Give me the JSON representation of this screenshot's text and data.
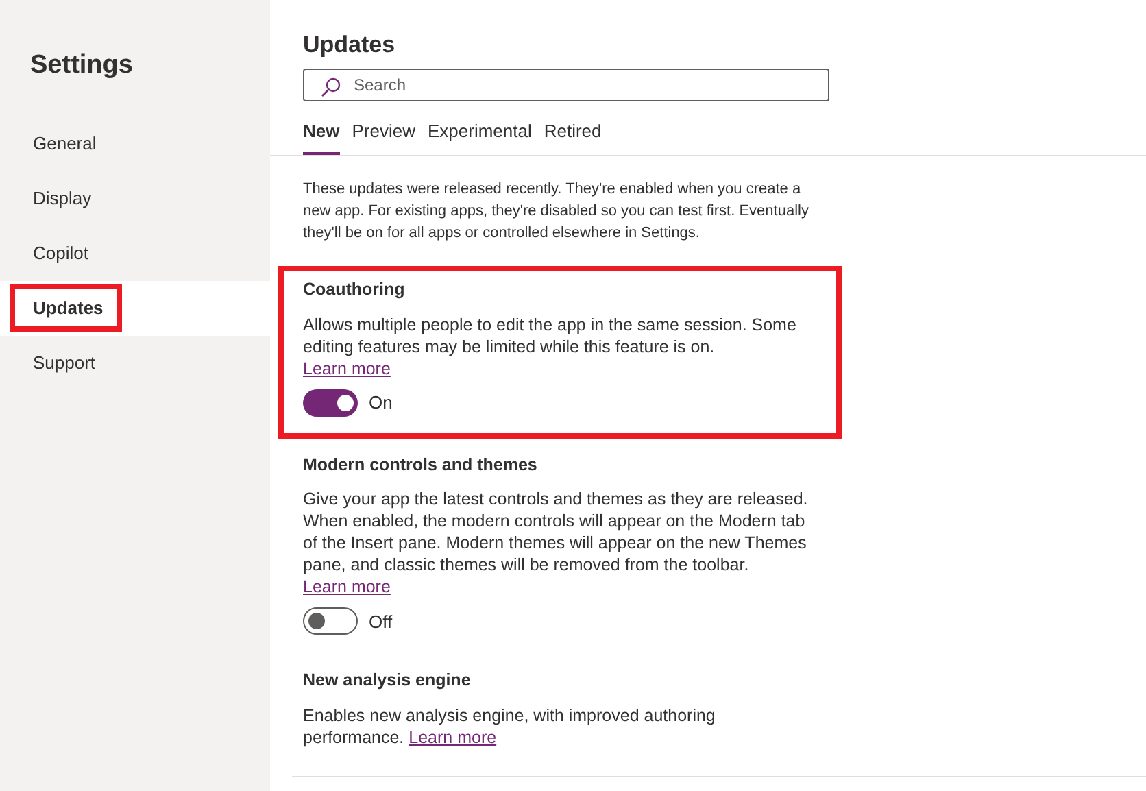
{
  "sidebar": {
    "title": "Settings",
    "items": [
      {
        "label": "General",
        "selected": false,
        "highlighted": false
      },
      {
        "label": "Display",
        "selected": false,
        "highlighted": false
      },
      {
        "label": "Copilot",
        "selected": false,
        "highlighted": false
      },
      {
        "label": "Updates",
        "selected": true,
        "highlighted": true
      },
      {
        "label": "Support",
        "selected": false,
        "highlighted": false
      }
    ]
  },
  "main": {
    "title": "Updates",
    "search": {
      "placeholder": "Search"
    },
    "tabs": [
      {
        "label": "New",
        "selected": true
      },
      {
        "label": "Preview",
        "selected": false
      },
      {
        "label": "Experimental",
        "selected": false
      },
      {
        "label": "Retired",
        "selected": false
      }
    ],
    "intro": "These updates were released recently. They're enabled when you create a new app. For existing apps, they're disabled so you can test first. Eventually they'll be on for all apps or controlled elsewhere in Settings.",
    "features": [
      {
        "title": "Coauthoring",
        "description": "Allows multiple people to edit the app in the same session. Some editing features may be limited while this feature is on.",
        "link": "Learn more",
        "highlighted": true,
        "toggle": {
          "on": true,
          "label": "On"
        }
      },
      {
        "title": "Modern controls and themes",
        "description": "Give your app the latest controls and themes as they are released. When enabled, the modern controls will appear on the Modern tab of the Insert pane. Modern themes will appear on the new Themes pane, and classic themes will be removed from the toolbar.",
        "link": "Learn more",
        "highlighted": false,
        "toggle": {
          "on": false,
          "label": "Off"
        }
      },
      {
        "title": "New analysis engine",
        "description": "Enables new analysis engine, with improved authoring performance.",
        "link": "Learn more",
        "highlighted": false
      }
    ]
  }
}
